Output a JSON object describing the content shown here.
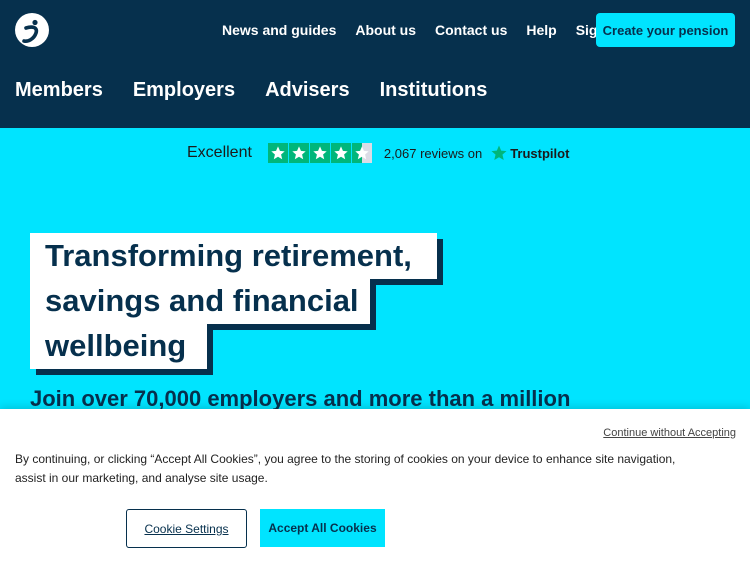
{
  "header": {
    "logo_icon": "brand-logo-icon",
    "utility_nav": [
      "News and guides",
      "About us",
      "Contact us",
      "Help",
      "Sign in"
    ],
    "cta_label": "Create your pension",
    "main_nav": [
      "Members",
      "Employers",
      "Advisers",
      "Institutions"
    ]
  },
  "trustpilot": {
    "rating_text": "Excellent",
    "stars": 4.5,
    "reviews_text": "2,067 reviews on",
    "brand": "Trustpilot"
  },
  "hero": {
    "lines": [
      "Transforming retirement,",
      "savings and financial",
      "wellbeing"
    ],
    "subtext": "Join over 70,000 employers and more than a million"
  },
  "cookie_banner": {
    "continue_link": "Continue without Accepting",
    "text": "By continuing, or clicking “Accept All Cookies”, you agree to the storing of cookies on your device to enhance site navigation, assist in our marketing, and analyse site usage.",
    "settings_label": "Cookie Settings",
    "accept_label": "Accept All Cookies"
  },
  "colors": {
    "navy": "#06304d",
    "cyan": "#00e4ff",
    "trustpilot_green": "#00b67a"
  }
}
